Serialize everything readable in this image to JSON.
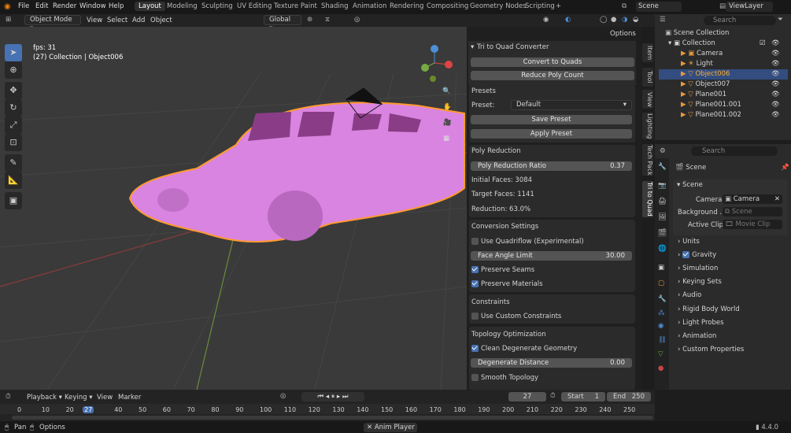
{
  "menu": [
    "File",
    "Edit",
    "Render",
    "Window",
    "Help"
  ],
  "workspaces": [
    "Layout",
    "Modeling",
    "Sculpting",
    "UV Editing",
    "Texture Paint",
    "Shading",
    "Animation",
    "Rendering",
    "Compositing",
    "Geometry Nodes",
    "Scripting"
  ],
  "scene_name": "Scene",
  "view_layer": "ViewLayer",
  "vp_header": {
    "mode": "Object Mode",
    "view": "View",
    "select": "Select",
    "add": "Add",
    "object": "Object",
    "orientation": "Global",
    "options": "Options"
  },
  "overlay": {
    "fps": "fps: 31",
    "collection": "(27) Collection | Object006"
  },
  "tabs": [
    "Item",
    "Tool",
    "View",
    "Lighting",
    "Tech Pack",
    "Tri to Quad"
  ],
  "addon": {
    "title": "Tri to Quad Converter",
    "convert": "Convert to Quads",
    "reduce": "Reduce Poly Count",
    "presets_h": "Presets",
    "preset_label": "Preset:",
    "preset_val": "Default",
    "save_preset": "Save Preset",
    "apply_preset": "Apply Preset",
    "polyred_h": "Poly Reduction",
    "ratio_label": "Poly Reduction Ratio",
    "ratio_val": "0.37",
    "initial": "Initial Faces: 3084",
    "target": "Target Faces: 1141",
    "reduction": "Reduction: 63.0%",
    "conv_h": "Conversion Settings",
    "quadriflow": "Use Quadriflow (Experimental)",
    "angle_label": "Face Angle Limit",
    "angle_val": "30.00",
    "seams": "Preserve Seams",
    "materials": "Preserve Materials",
    "constraints_h": "Constraints",
    "custom_constraints": "Use Custom Constraints",
    "topo_h": "Topology Optimization",
    "clean": "Clean Degenerate Geometry",
    "degen_label": "Degenerate Distance",
    "degen_val": "0.00",
    "smooth": "Smooth Topology"
  },
  "outliner": {
    "root": "Scene Collection",
    "collection": "Collection",
    "items": [
      "Camera",
      "Light",
      "Object006",
      "Object007",
      "Plane001",
      "Plane001.001",
      "Plane001.002"
    ],
    "search": "Search"
  },
  "props": {
    "search": "Search",
    "scene_title": "Scene",
    "panel": "Scene",
    "camera_label": "Camera",
    "camera_val": "Camera",
    "bg_label": "Background ...",
    "bg_val": "Scene",
    "clip_label": "Active Clip",
    "clip_val": "Movie Clip",
    "sections": [
      "Units",
      "Gravity",
      "Simulation",
      "Keying Sets",
      "Audio",
      "Rigid Body World",
      "Light Probes",
      "Animation",
      "Custom Properties"
    ]
  },
  "timeline": {
    "playback": "Playback",
    "keying": "Keying",
    "view": "View",
    "marker": "Marker",
    "frame": "27",
    "start_label": "Start",
    "start": "1",
    "end_label": "End",
    "end": "250",
    "ticks": [
      "0",
      "10",
      "20",
      "27",
      "40",
      "50",
      "60",
      "70",
      "80",
      "90",
      "100",
      "110",
      "120",
      "130",
      "140",
      "150",
      "160",
      "170",
      "180",
      "190",
      "200",
      "210",
      "220",
      "230",
      "240",
      "250"
    ]
  },
  "status": {
    "pan": "Pan",
    "options": "Options",
    "anim": "Anim Player",
    "version": "4.4.0"
  },
  "colors": {
    "accent": "#4772b3",
    "selected": "#ff9a2f",
    "car": "#d984e0"
  }
}
